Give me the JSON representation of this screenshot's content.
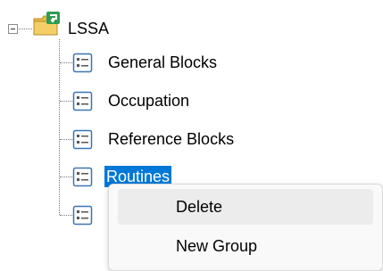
{
  "tree": {
    "root": {
      "label": "LSSA",
      "icon": "project-folder-icon",
      "expanded": true
    },
    "children": [
      {
        "label": "General Blocks",
        "icon": "list-document-icon"
      },
      {
        "label": "Occupation",
        "icon": "list-document-icon"
      },
      {
        "label": "Reference Blocks",
        "icon": "list-document-icon"
      },
      {
        "label": "Routines",
        "icon": "list-document-icon",
        "selected": true
      },
      {
        "label": "",
        "icon": "list-document-icon"
      }
    ]
  },
  "context_menu": {
    "items": [
      {
        "label": "Delete",
        "hovered": true
      },
      {
        "label": "New Group"
      }
    ]
  },
  "colors": {
    "selection": "#0078d7",
    "icon_border": "#3a74b8",
    "menu_hover": "#ececec"
  }
}
